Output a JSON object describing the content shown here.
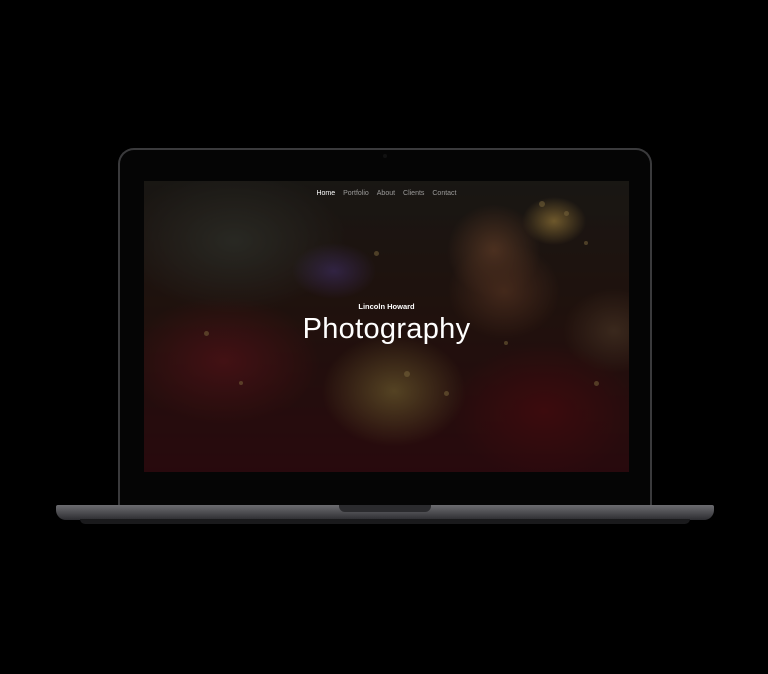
{
  "nav": {
    "items": [
      {
        "label": "Home",
        "active": true
      },
      {
        "label": "Portfolio",
        "active": false
      },
      {
        "label": "About",
        "active": false
      },
      {
        "label": "Clients",
        "active": false
      },
      {
        "label": "Contact",
        "active": false
      }
    ]
  },
  "hero": {
    "subtitle": "Lincoln Howard",
    "title": "Photography"
  },
  "colors": {
    "background": "#000000",
    "text": "#ffffff",
    "nav_inactive": "rgba(255,255,255,0.55)",
    "laptop_frame": "#3a3a3c",
    "laptop_base": "#5a5a5e"
  }
}
